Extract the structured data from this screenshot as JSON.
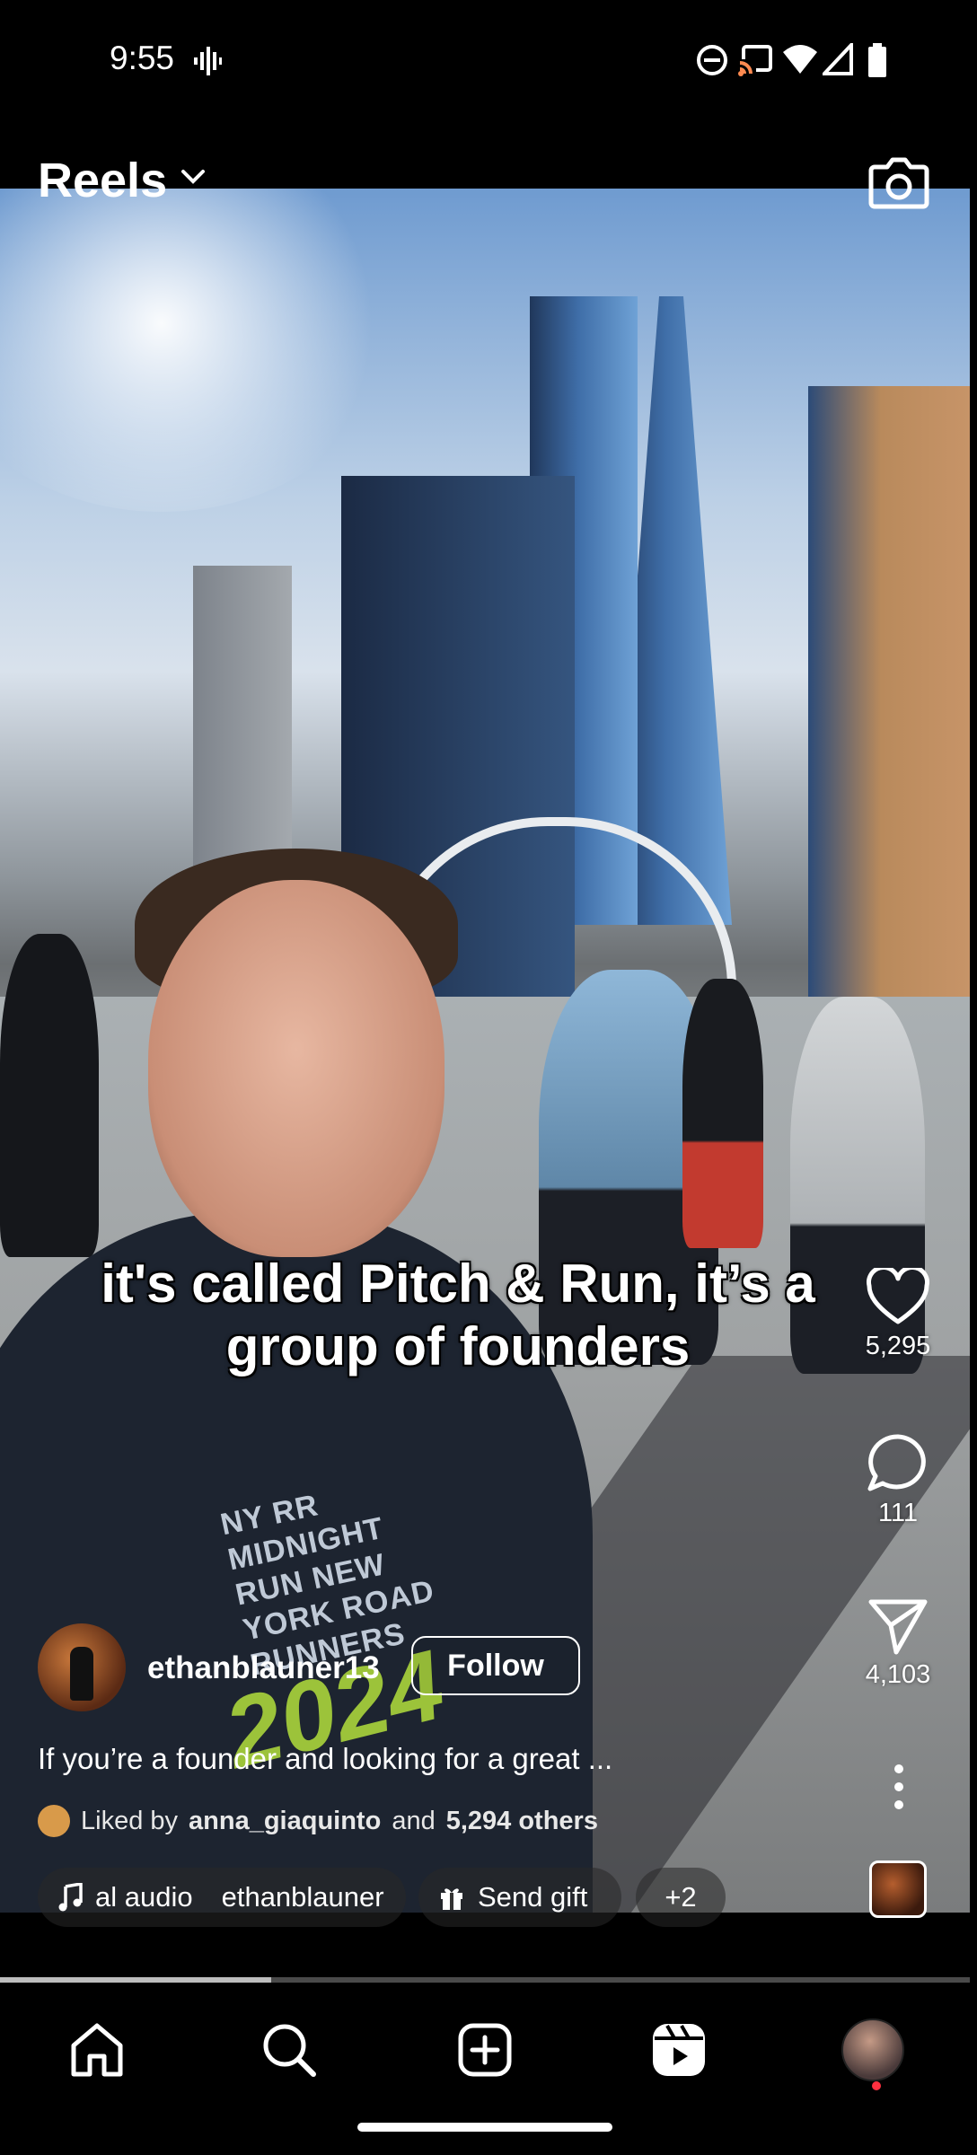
{
  "status": {
    "time": "9:55",
    "icons": [
      "voicemail-icon",
      "do-not-disturb-icon",
      "cast-icon",
      "wifi-icon",
      "signal-icon",
      "battery-icon"
    ]
  },
  "header": {
    "title": "Reels",
    "chevron_icon": "chevron-down-icon",
    "camera_icon": "camera-icon"
  },
  "video": {
    "caption": "it's called Pitch & Run, it’s a group of founders",
    "shirt_print": "NY RR MIDNIGHT RUN NEW YORK ROAD RUNNERS",
    "shirt_year": "2024"
  },
  "actions": {
    "likes": "5,295",
    "comments": "111",
    "shares": "4,103"
  },
  "post": {
    "username": "ethanblauner13",
    "follow_label": "Follow",
    "description": "If you’re a founder and looking for a great ...",
    "liked_prefix": "Liked by",
    "liked_user": "anna_giaquinto",
    "liked_and": "and",
    "liked_others": "5,294 others"
  },
  "chips": {
    "audio_label": "al audio",
    "audio_user": "ethanblauner",
    "gift_label": "Send gift",
    "more_label": "+2"
  },
  "progress": {
    "fraction": 0.28
  },
  "nav": {
    "items": [
      "home-icon",
      "search-icon",
      "create-icon",
      "reels-icon",
      "profile-avatar"
    ],
    "accent": "#ff3040"
  }
}
